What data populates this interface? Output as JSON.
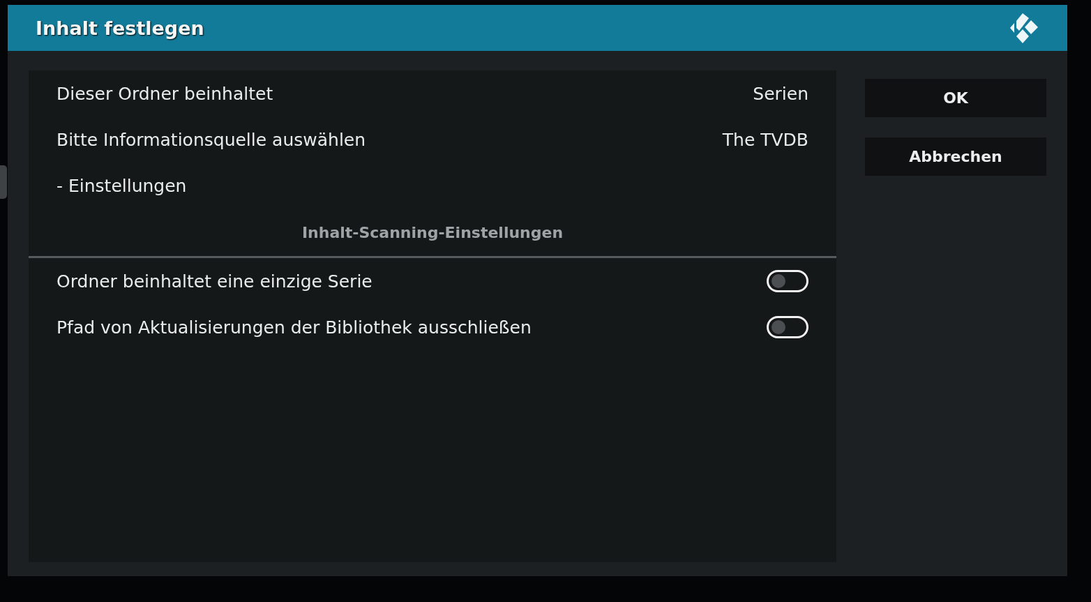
{
  "window": {
    "title": "Inhalt festlegen"
  },
  "settings": [
    {
      "kind": "value",
      "label": "Dieser Ordner beinhaltet",
      "value": "Serien"
    },
    {
      "kind": "value",
      "label": "Bitte Informationsquelle auswählen",
      "value": "The TVDB"
    },
    {
      "kind": "text",
      "label": "- Einstellungen"
    },
    {
      "kind": "heading",
      "label": "Inhalt-Scanning-Einstellungen"
    },
    {
      "kind": "toggle",
      "label": "Ordner beinhaltet eine einzige Serie",
      "on": false
    },
    {
      "kind": "toggle",
      "label": "Pfad von Aktualisierungen der Bibliothek ausschließen",
      "on": false
    }
  ],
  "buttons": [
    "OK",
    "Abbrechen"
  ]
}
